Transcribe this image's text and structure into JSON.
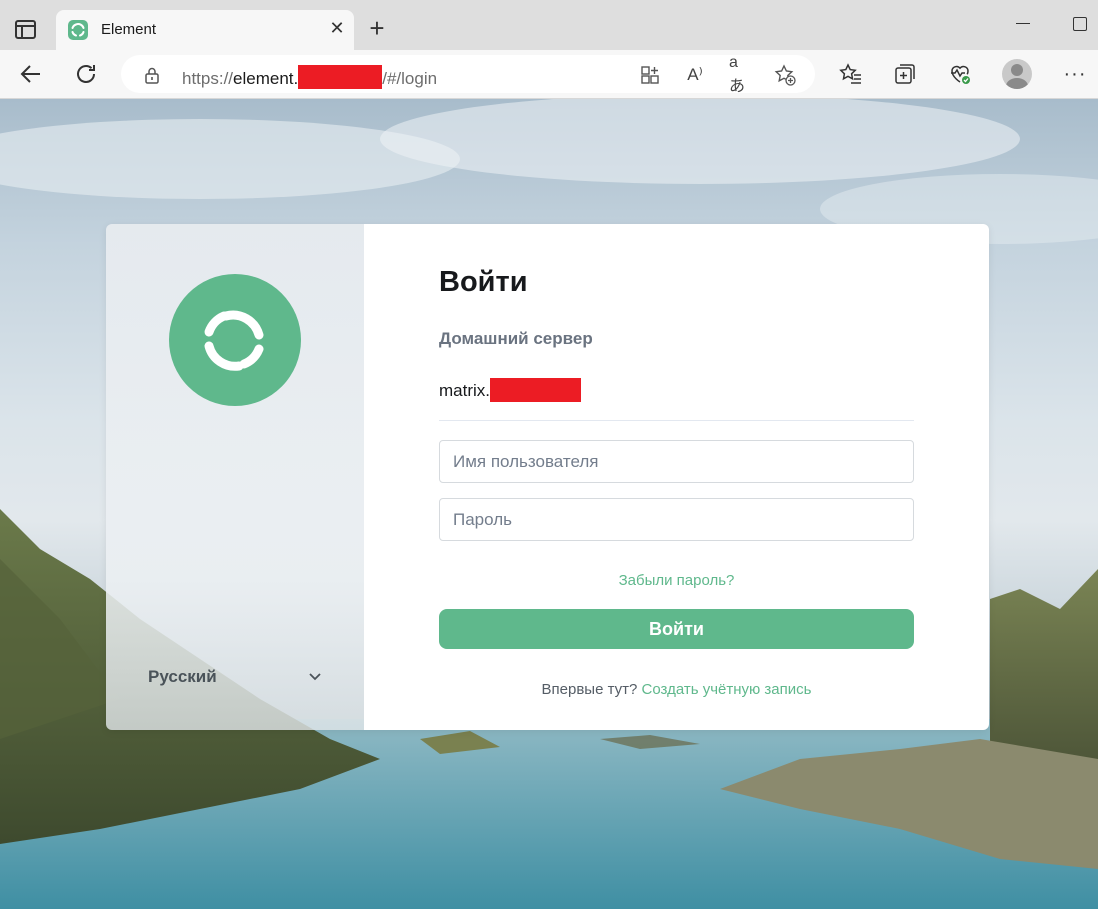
{
  "browser": {
    "tab_title": "Element",
    "url_prefix": "https://",
    "url_host": "element.",
    "url_path": "/#/login"
  },
  "login": {
    "title": "Войти",
    "homeserver_label": "Домашний сервер",
    "homeserver_value": "matrix.",
    "username_placeholder": "Имя пользователя",
    "password_placeholder": "Пароль",
    "forgot_password": "Забыли пароль?",
    "submit_label": "Войти",
    "signup_prompt": "Впервые тут?",
    "signup_link": "Создать учётную запись"
  },
  "language": {
    "selected": "Русский"
  },
  "colors": {
    "accent": "#5fb88c",
    "redaction": "#ec1c24"
  },
  "icons": [
    "sidebar-tabs-icon",
    "element-favicon",
    "close-icon",
    "plus-icon",
    "back-arrow-icon",
    "refresh-icon",
    "lock-icon",
    "app-grid-icon",
    "read-aloud-icon",
    "translate-icon",
    "add-favorite-icon",
    "favorites-icon",
    "collections-icon",
    "browser-essentials-icon",
    "profile-avatar",
    "more-icon",
    "element-logo",
    "chevron-down-icon"
  ]
}
